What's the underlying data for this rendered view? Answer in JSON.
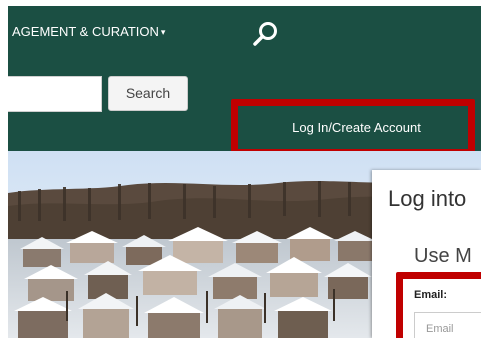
{
  "nav": {
    "menu_label": "AGEMENT & CURATION",
    "caret": "▾",
    "search_icon": "search-icon"
  },
  "search": {
    "value": "",
    "button_label": "Search"
  },
  "account": {
    "login_label": "Log In/Create Account"
  },
  "login_panel": {
    "title": "Log into",
    "subtitle": "Use M",
    "email_label": "Email:",
    "email_placeholder": "Email"
  },
  "colors": {
    "header_bg": "#1b4f43",
    "highlight": "#c00000"
  }
}
